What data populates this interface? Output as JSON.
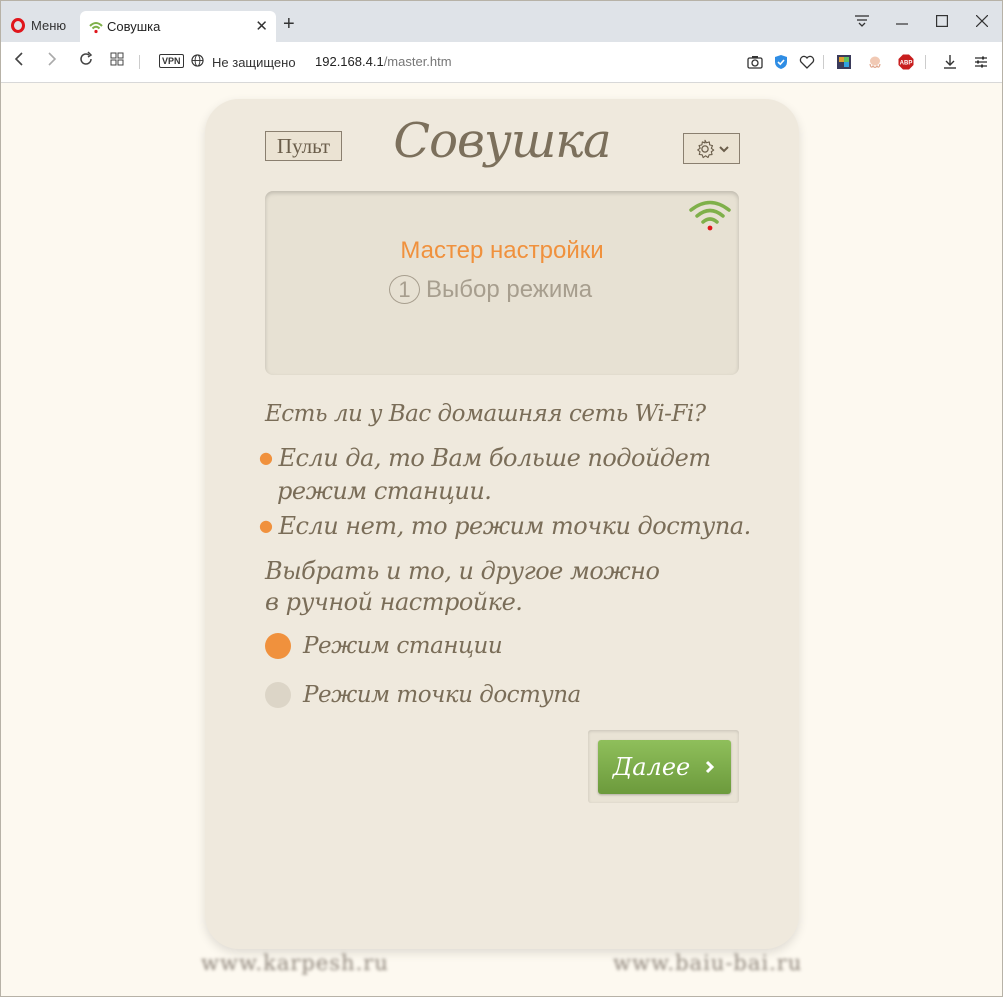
{
  "browser": {
    "menu_label": "Меню",
    "tab_title": "Совушка",
    "vpn_label": "VPN",
    "security_label": "Не защищено",
    "url_host": "192.168.4.1",
    "url_path": "/master.htm",
    "abp_label": "ABP"
  },
  "header": {
    "remote_button": "Пульт",
    "logo_title": "Совушка"
  },
  "status": {
    "wizard_title": "Мастер настройки",
    "step_number": "1",
    "step_label": "Выбор режима",
    "wifi_color": "#7fb04a",
    "wifi_dot_color": "#e0161c"
  },
  "content": {
    "question": "Есть ли у Вас домашняя сеть Wi-Fi?",
    "bullet1_line1": "Если да, то Вам больше подойдет",
    "bullet1_line2": "режим станции.",
    "bullet2": "Если нет, то режим точки доступа.",
    "note_line1": "Выбрать и то, и другое можно",
    "note_line2": "в ручной настройке."
  },
  "mode_options": [
    {
      "label": "Режим станции",
      "selected": true
    },
    {
      "label": "Режим точки доступа",
      "selected": false
    }
  ],
  "next_button": "Далее",
  "footer": {
    "left_link": "www.karpesh.ru",
    "right_link": "www.baiu-bai.ru"
  },
  "colors": {
    "accent": "#f0913d",
    "card_bg": "#efe9dd",
    "text": "#7a6d58",
    "button_green": "#7fae4a"
  }
}
